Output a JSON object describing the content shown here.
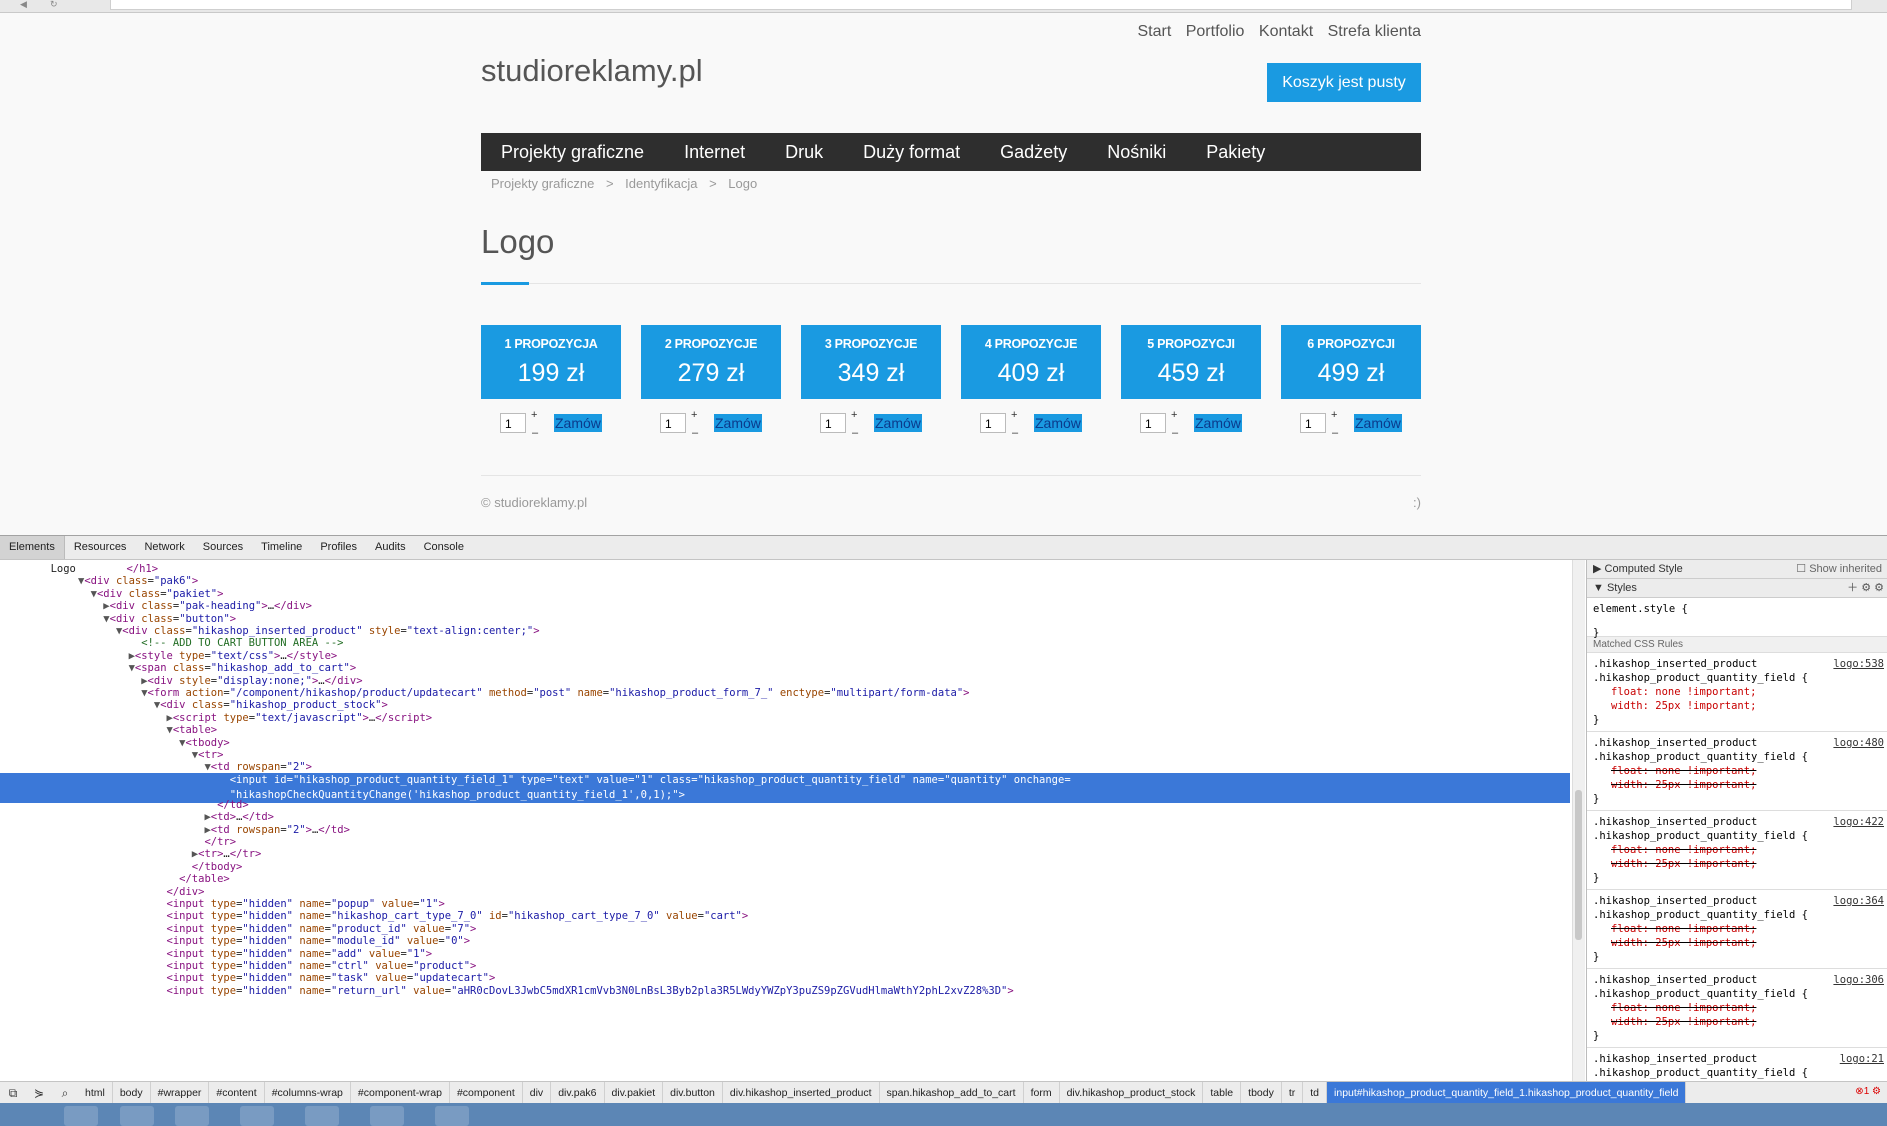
{
  "site": {
    "topnav": [
      "Start",
      "Portfolio",
      "Kontakt",
      "Strefa klienta"
    ],
    "logo": "studioreklamy.pl",
    "cart_button": "Koszyk jest pusty",
    "menu": [
      "Projekty graficzne",
      "Internet",
      "Druk",
      "Duży format",
      "Gadżety",
      "Nośniki",
      "Pakiety"
    ],
    "breadcrumb": [
      "Projekty graficzne",
      "Identyfikacja",
      "Logo"
    ],
    "breadcrumb_sep": ">",
    "page_title": "Logo",
    "packages": [
      {
        "title": "1 PROPOZYCJA",
        "price": "199 zł",
        "qty": "1",
        "order": "Zamów"
      },
      {
        "title": "2 PROPOZYCJE",
        "price": "279 zł",
        "qty": "1",
        "order": "Zamów"
      },
      {
        "title": "3 PROPOZYCJE",
        "price": "349 zł",
        "qty": "1",
        "order": "Zamów"
      },
      {
        "title": "4 PROPOZYCJE",
        "price": "409 zł",
        "qty": "1",
        "order": "Zamów"
      },
      {
        "title": "5 PROPOZYCJI",
        "price": "459 zł",
        "qty": "1",
        "order": "Zamów"
      },
      {
        "title": "6 PROPOZYCJI",
        "price": "499 zł",
        "qty": "1",
        "order": "Zamów"
      }
    ],
    "qty_plus": "+",
    "qty_minus": "–",
    "footer_copy": "© studioreklamy.pl",
    "footer_right": ":)"
  },
  "devtools": {
    "tabs": [
      "Elements",
      "Resources",
      "Network",
      "Sources",
      "Timeline",
      "Profiles",
      "Audits",
      "Console"
    ],
    "active_tab": "Elements",
    "dom_lines": [
      "<span class=\"tri\"></span>        Logo        <span class=\"tag\">&lt;/h1&gt;</span>",
      "<span class=\"tri\">▼</span><span class=\"tag\">&lt;div</span> <span class=\"attr\">class</span>=<span class=\"val\">\"pak6\"</span><span class=\"tag\">&gt;</span>",
      "  <span class=\"tri\">▼</span><span class=\"tag\">&lt;div</span> <span class=\"attr\">class</span>=<span class=\"val\">\"pakiet\"</span><span class=\"tag\">&gt;</span>",
      "    <span class=\"tri\">▶</span><span class=\"tag\">&lt;div</span> <span class=\"attr\">class</span>=<span class=\"val\">\"pak-heading\"</span><span class=\"tag\">&gt;</span>…<span class=\"tag\">&lt;/div&gt;</span>",
      "    <span class=\"tri\">▼</span><span class=\"tag\">&lt;div</span> <span class=\"attr\">class</span>=<span class=\"val\">\"button\"</span><span class=\"tag\">&gt;</span>",
      "      <span class=\"tri\">▼</span><span class=\"tag\">&lt;div</span> <span class=\"attr\">class</span>=<span class=\"val\">\"hikashop_inserted_product\"</span> <span class=\"attr\">style</span>=<span class=\"val\">\"text-align:center;\"</span><span class=\"tag\">&gt;</span>",
      "          <span class=\"cmt\">&lt;!-- ADD TO CART BUTTON AREA --&gt;</span>",
      "        <span class=\"tri\">▶</span><span class=\"tag\">&lt;style</span> <span class=\"attr\">type</span>=<span class=\"val\">\"text/css\"</span><span class=\"tag\">&gt;</span>…<span class=\"tag\">&lt;/style&gt;</span>",
      "        <span class=\"tri\">▼</span><span class=\"tag\">&lt;span</span> <span class=\"attr\">class</span>=<span class=\"val\">\"hikashop_add_to_cart\"</span><span class=\"tag\">&gt;</span>",
      "          <span class=\"tri\">▶</span><span class=\"tag\">&lt;div</span> <span class=\"attr\">style</span>=<span class=\"val\">\"display:none;\"</span><span class=\"tag\">&gt;</span>…<span class=\"tag\">&lt;/div&gt;</span>",
      "          <span class=\"tri\">▼</span><span class=\"tag\">&lt;form</span> <span class=\"attr\">action</span>=<span class=\"val\">\"/component/hikashop/product/updatecart\"</span> <span class=\"attr\">method</span>=<span class=\"val\">\"post\"</span> <span class=\"attr\">name</span>=<span class=\"val\">\"hikashop_product_form_7_\"</span> <span class=\"attr\">enctype</span>=<span class=\"val\">\"multipart/form-data\"</span><span class=\"tag\">&gt;</span>",
      "            <span class=\"tri\">▼</span><span class=\"tag\">&lt;div</span> <span class=\"attr\">class</span>=<span class=\"val\">\"hikashop_product_stock\"</span><span class=\"tag\">&gt;</span>",
      "              <span class=\"tri\">▶</span><span class=\"tag\">&lt;script</span> <span class=\"attr\">type</span>=<span class=\"val\">\"text/javascript\"</span><span class=\"tag\">&gt;</span>…<span class=\"tag\">&lt;/script&gt;</span>",
      "              <span class=\"tri\">▼</span><span class=\"tag\">&lt;table&gt;</span>",
      "                <span class=\"tri\">▼</span><span class=\"tag\">&lt;tbody&gt;</span>",
      "                  <span class=\"tri\">▼</span><span class=\"tag\">&lt;tr&gt;</span>",
      "                    <span class=\"tri\">▼</span><span class=\"tag\">&lt;td</span> <span class=\"attr\">rowspan</span>=<span class=\"val\">\"2\"</span><span class=\"tag\">&gt;</span>",
      "                        <span class=\"tag\">&lt;input</span> <span class=\"attr\">id</span>=<span class=\"val\">\"hikashop_product_quantity_field_1\"</span> <span class=\"attr\">type</span>=<span class=\"val\">\"text\"</span> <span class=\"attr\">value</span>=<span class=\"val\">\"1\"</span> <span class=\"attr\">class</span>=<span class=\"val\">\"hikashop_product_quantity_field\"</span> <span class=\"attr\">name</span>=<span class=\"val\">\"quantity\"</span> <span class=\"attr\">onchange</span>=\n                        <span class=\"val\">\"hikashopCheckQuantityChange('hikashop_product_quantity_field_1',0,1);\"</span><span class=\"tag\">&gt;</span>",
      "                      <span class=\"tag\">&lt;/td&gt;</span>",
      "                    <span class=\"tri\">▶</span><span class=\"tag\">&lt;td&gt;</span>…<span class=\"tag\">&lt;/td&gt;</span>",
      "                    <span class=\"tri\">▶</span><span class=\"tag\">&lt;td</span> <span class=\"attr\">rowspan</span>=<span class=\"val\">\"2\"</span><span class=\"tag\">&gt;</span>…<span class=\"tag\">&lt;/td&gt;</span>",
      "                    <span class=\"tag\">&lt;/tr&gt;</span>",
      "                  <span class=\"tri\">▶</span><span class=\"tag\">&lt;tr&gt;</span>…<span class=\"tag\">&lt;/tr&gt;</span>",
      "                  <span class=\"tag\">&lt;/tbody&gt;</span>",
      "                <span class=\"tag\">&lt;/table&gt;</span>",
      "              <span class=\"tag\">&lt;/div&gt;</span>",
      "              <span class=\"tag\">&lt;input</span> <span class=\"attr\">type</span>=<span class=\"val\">\"hidden\"</span> <span class=\"attr\">name</span>=<span class=\"val\">\"popup\"</span> <span class=\"attr\">value</span>=<span class=\"val\">\"1\"</span><span class=\"tag\">&gt;</span>",
      "              <span class=\"tag\">&lt;input</span> <span class=\"attr\">type</span>=<span class=\"val\">\"hidden\"</span> <span class=\"attr\">name</span>=<span class=\"val\">\"hikashop_cart_type_7_0\"</span> <span class=\"attr\">id</span>=<span class=\"val\">\"hikashop_cart_type_7_0\"</span> <span class=\"attr\">value</span>=<span class=\"val\">\"cart\"</span><span class=\"tag\">&gt;</span>",
      "              <span class=\"tag\">&lt;input</span> <span class=\"attr\">type</span>=<span class=\"val\">\"hidden\"</span> <span class=\"attr\">name</span>=<span class=\"val\">\"product_id\"</span> <span class=\"attr\">value</span>=<span class=\"val\">\"7\"</span><span class=\"tag\">&gt;</span>",
      "              <span class=\"tag\">&lt;input</span> <span class=\"attr\">type</span>=<span class=\"val\">\"hidden\"</span> <span class=\"attr\">name</span>=<span class=\"val\">\"module_id\"</span> <span class=\"attr\">value</span>=<span class=\"val\">\"0\"</span><span class=\"tag\">&gt;</span>",
      "              <span class=\"tag\">&lt;input</span> <span class=\"attr\">type</span>=<span class=\"val\">\"hidden\"</span> <span class=\"attr\">name</span>=<span class=\"val\">\"add\"</span> <span class=\"attr\">value</span>=<span class=\"val\">\"1\"</span><span class=\"tag\">&gt;</span>",
      "              <span class=\"tag\">&lt;input</span> <span class=\"attr\">type</span>=<span class=\"val\">\"hidden\"</span> <span class=\"attr\">name</span>=<span class=\"val\">\"ctrl\"</span> <span class=\"attr\">value</span>=<span class=\"val\">\"product\"</span><span class=\"tag\">&gt;</span>",
      "              <span class=\"tag\">&lt;input</span> <span class=\"attr\">type</span>=<span class=\"val\">\"hidden\"</span> <span class=\"attr\">name</span>=<span class=\"val\">\"task\"</span> <span class=\"attr\">value</span>=<span class=\"val\">\"updatecart\"</span><span class=\"tag\">&gt;</span>",
      "              <span class=\"tag\">&lt;input</span> <span class=\"attr\">type</span>=<span class=\"val\">\"hidden\"</span> <span class=\"attr\">name</span>=<span class=\"val\">\"return_url\"</span> <span class=\"attr\">value</span>=<span class=\"val\">\"aHR0cDovL3JwbC5mdXR1cmVvb3N0LnBsL3Byb2pla3R5LWdyYWZpY3puZS9pZGVudHlmaWthY2phL2xvZ28%3D\"</span><span class=\"tag\">&gt;</span>"
    ],
    "styles": {
      "computed_header": "Computed Style",
      "show_inherited": "Show inherited",
      "styles_header": "Styles",
      "element_style": "element.style {",
      "element_style_close": "}",
      "matched_header": "Matched CSS Rules",
      "rules": [
        {
          "selector1": ".hikashop_inserted_product",
          "selector2": ".hikashop_product_quantity_field {",
          "src": "logo:538",
          "p1": "float: none !important;",
          "p2": "width: 25px !important;",
          "over": false
        },
        {
          "selector1": ".hikashop_inserted_product",
          "selector2": ".hikashop_product_quantity_field {",
          "src": "logo:480",
          "p1": "float: none !important;",
          "p2": "width: 25px !important;",
          "over": true
        },
        {
          "selector1": ".hikashop_inserted_product",
          "selector2": ".hikashop_product_quantity_field {",
          "src": "logo:422",
          "p1": "float: none !important;",
          "p2": "width: 25px !important;",
          "over": true
        },
        {
          "selector1": ".hikashop_inserted_product",
          "selector2": ".hikashop_product_quantity_field {",
          "src": "logo:364",
          "p1": "float: none !important;",
          "p2": "width: 25px !important;",
          "over": true
        },
        {
          "selector1": ".hikashop_inserted_product",
          "selector2": ".hikashop_product_quantity_field {",
          "src": "logo:306",
          "p1": "float: none !important;",
          "p2": "width: 25px !important;",
          "over": true
        },
        {
          "selector1": ".hikashop_inserted_product",
          "selector2": ".hikashop_product_quantity_field {",
          "src": "logo:21",
          "p1": "",
          "p2": "",
          "over": false
        }
      ]
    },
    "crumbs": [
      "html",
      "body",
      "#wrapper",
      "#content",
      "#columns-wrap",
      "#component-wrap",
      "#component",
      "div",
      "div.pak6",
      "div.pakiet",
      "div.button",
      "div.hikashop_inserted_product",
      "span.hikashop_add_to_cart",
      "form",
      "div.hikashop_product_stock",
      "table",
      "tbody",
      "tr",
      "td",
      "input#hikashop_product_quantity_field_1.hikashop_product_quantity_field"
    ],
    "error_count": "1"
  },
  "colors": {
    "accent": "#1a9ae1",
    "menu_bg": "#2e2e2e",
    "selection": "#3b78d8"
  }
}
